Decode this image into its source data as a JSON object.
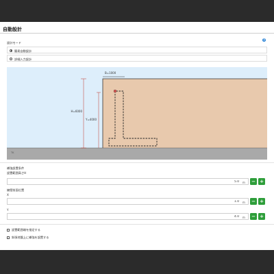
{
  "title": "自動設計",
  "mode_section": {
    "label": "設計モード",
    "help_glyph": "?",
    "options": [
      {
        "label": "簡易自動設計",
        "selected": true
      },
      {
        "label": "詳細入力設計",
        "selected": false
      }
    ]
  },
  "diagram": {
    "width_label": "B=1000",
    "height_label_outer": "H=6000",
    "height_label_inner": "Y=4000",
    "ground_label": "TK"
  },
  "conditions": {
    "section_title": "補強設置条件",
    "height_label": "設置範囲高さH",
    "height_value": "5.0",
    "height_unit": "m",
    "position_title": "擁壁前面位置",
    "x_label": "X",
    "x_value": "1.0",
    "x_unit": "m",
    "y_label": "Y",
    "y_value": "4.0",
    "y_unit": "m",
    "minus_glyph": "−",
    "plus_glyph": "+"
  },
  "checks": [
    {
      "label": "設置範囲端を指定する",
      "checked": false
    },
    {
      "label": "斜張地盤上に補強を設置する",
      "checked": false
    }
  ],
  "colors": {
    "sky": "#ddeefb",
    "soil": "#e8c9ad",
    "ground": "#a9a9a9",
    "dimension": "#c0392b",
    "button": "#2e9e3a"
  }
}
